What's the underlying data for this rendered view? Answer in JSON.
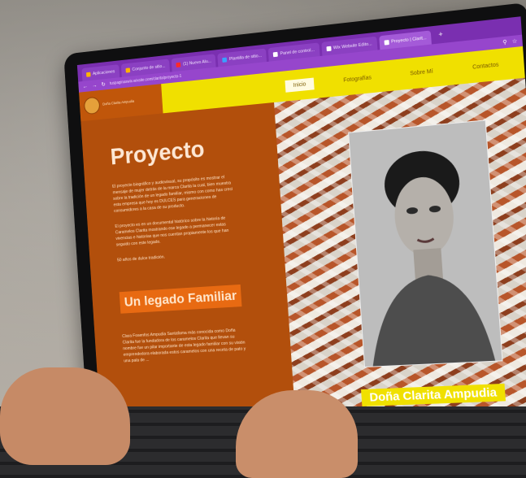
{
  "browser": {
    "tabs": [
      {
        "label": "Aplicaciones"
      },
      {
        "label": "Conjunto de sitio..."
      },
      {
        "label": "(1) Nuevo Alu..."
      },
      {
        "label": "Plantilla de sitio..."
      },
      {
        "label": "Panel de control..."
      },
      {
        "label": "Wix Website Edito..."
      },
      {
        "label": "Proyecto | Clarit..."
      }
    ],
    "new_tab": "+",
    "url": "tuspaginaswix.wixsite.com/clarita/proyecto-1"
  },
  "site": {
    "logo_text": "Doña Clarita Ampudia",
    "nav": [
      "Inicio",
      "Fotografías",
      "Sobre Mí",
      "Contactos"
    ],
    "title": "Proyecto",
    "paragraphs": [
      "El proyecto biográfico y audiovisual, su propósito es mostrar el mensaje de mujer detrás de la marca Clarita la cual, bien muestra sobre la tradición de un legado familiar, mismo con como has creci esta empresa que hoy es DULCES para generaciones de consumidores a la casa de su producto.",
      "El proyecto es en un documental histórico sobre la historia de Caramelos Clarita mostrando ese legado a permanecer estas vivencias e historias que nos cuentan propiamente los que han seguido con este legado.",
      "50 años de dulce tradición."
    ],
    "subheading": "Un legado Familiar",
    "paragraph2": "Clara Fosenfos Ampudia Santafama más conocida como Doña Clarita fue la fundadora de los caramelos Clarita que llevan su nombre fue un pilar importante de esta legado familiar con su visión emprendedora elaborada estos caramelos con una receta de pato y una pala de ...",
    "photo_caption": "Doña Clarita Ampudia"
  },
  "colors": {
    "browser_purple": "#7a2fb0",
    "nav_yellow": "#f0e000",
    "panel_orange": "#b24f0c",
    "subhead_orange": "#e86a12"
  }
}
